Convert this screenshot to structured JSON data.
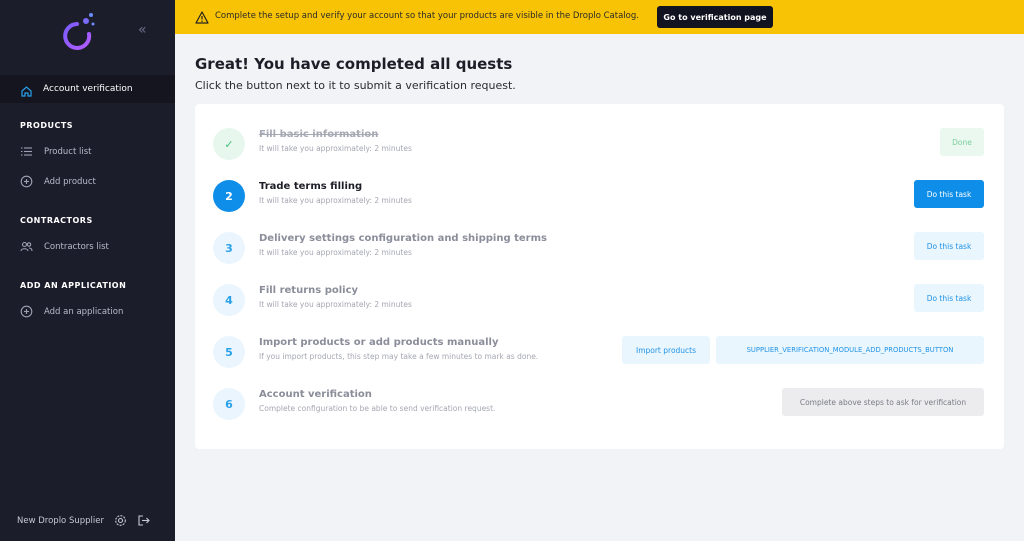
{
  "banner": {
    "message": "Complete the setup and verify your account so that your products are visible in the Droplo Catalog.",
    "button_label": "Go to verification page"
  },
  "sidebar": {
    "active_item": "Account verification",
    "sections": [
      {
        "title": "PRODUCTS",
        "items": [
          "Product list",
          "Add product"
        ]
      },
      {
        "title": "CONTRACTORS",
        "items": [
          "Contractors list"
        ]
      },
      {
        "title": "ADD AN APPLICATION",
        "items": [
          "Add an application"
        ]
      }
    ],
    "user_name": "New Droplo Supplier"
  },
  "main": {
    "title": "Great! You have completed all quests",
    "subtitle": "Click the button next to it to submit a verification request.",
    "tasks": [
      {
        "marker": "✓",
        "title": "Fill basic information",
        "subtitle": "It will take you approximately: 2 minutes",
        "buttons": [
          "Done"
        ],
        "state": "done"
      },
      {
        "marker": "2",
        "title": "Trade terms filling",
        "subtitle": "It will take you approximately: 2 minutes",
        "buttons": [
          "Do this task"
        ],
        "state": "active"
      },
      {
        "marker": "3",
        "title": "Delivery settings configuration and shipping terms",
        "subtitle": "It will take you approximately: 2 minutes",
        "buttons": [
          "Do this task"
        ],
        "state": "pending"
      },
      {
        "marker": "4",
        "title": "Fill returns policy",
        "subtitle": "It will take you approximately: 2 minutes",
        "buttons": [
          "Do this task"
        ],
        "state": "pending"
      },
      {
        "marker": "5",
        "title": "Import products or add products manually",
        "subtitle": "If you import products, this step may take a few minutes to mark as done.",
        "buttons": [
          "Import products",
          "SUPPLIER_VERIFICATION_MODULE_ADD_PRODUCTS_BUTTON"
        ],
        "state": "pending"
      },
      {
        "marker": "6",
        "title": "Account verification",
        "subtitle": "Complete configuration to be able to send verification request.",
        "buttons": [
          "Complete above steps to ask for verification"
        ],
        "state": "pending"
      }
    ]
  },
  "colors": {
    "banner": "#f8c305",
    "sidebar": "#1c1d2b",
    "accent": "#0e8ee8",
    "done": "#3fc27c"
  }
}
